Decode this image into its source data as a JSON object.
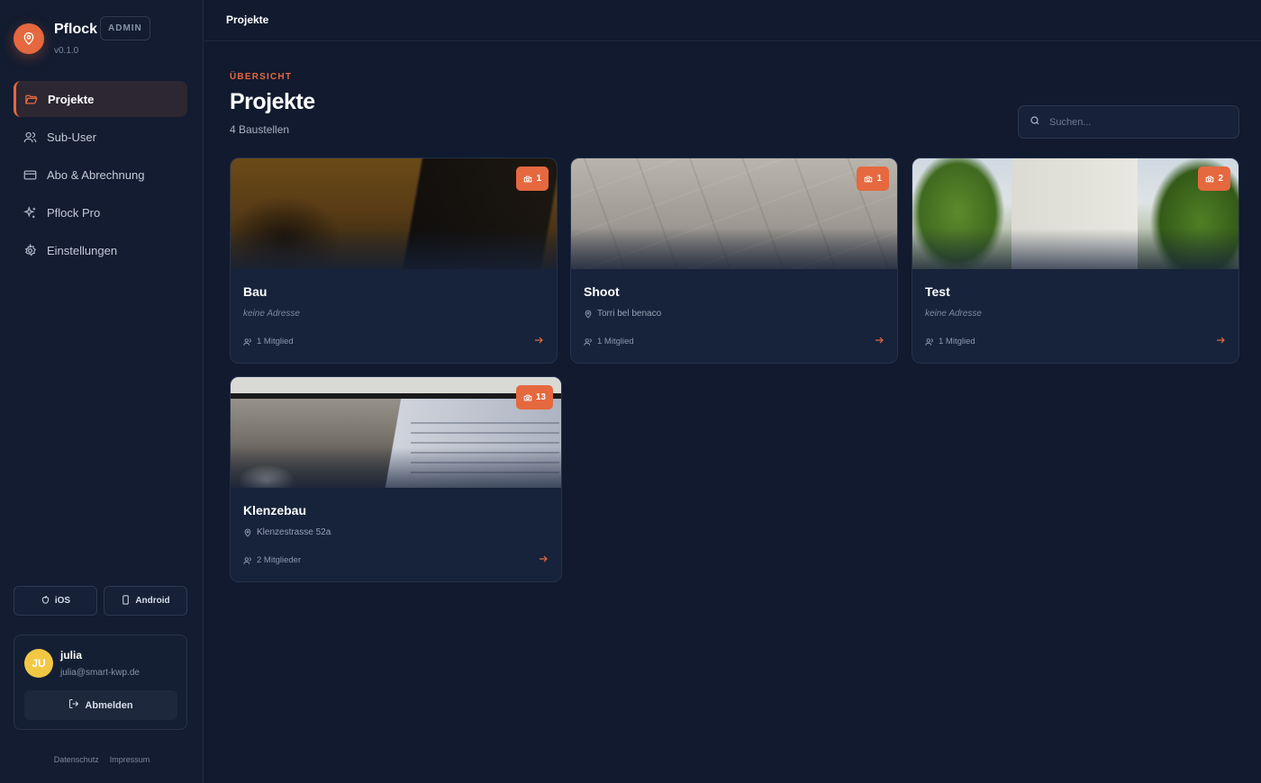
{
  "brand": {
    "name": "Pflock",
    "badge": "ADMIN",
    "version": "v0.1.0"
  },
  "nav": [
    {
      "label": "Projekte",
      "icon": "folder-icon",
      "active": true
    },
    {
      "label": "Sub-User",
      "icon": "users-icon"
    },
    {
      "label": "Abo & Abrechnung",
      "icon": "credit-card-icon"
    },
    {
      "label": "Pflock Pro",
      "icon": "sparkles-icon"
    },
    {
      "label": "Einstellungen",
      "icon": "gear-icon"
    }
  ],
  "apps": {
    "ios": "iOS",
    "android": "Android"
  },
  "user": {
    "initials": "JU",
    "name": "julia",
    "email": "julia@smart-kwp.de",
    "logout": "Abmelden"
  },
  "footer": {
    "privacy": "Datenschutz",
    "imprint": "Impressum"
  },
  "topbar": {
    "title": "Projekte"
  },
  "header": {
    "eyebrow": "ÜBERSICHT",
    "title": "Projekte",
    "subtitle": "4 Baustellen"
  },
  "search": {
    "placeholder": "Suchen..."
  },
  "projects": [
    {
      "title": "Bau",
      "address": "keine Adresse",
      "members": "1 Mitglied",
      "photos": "1"
    },
    {
      "title": "Shoot",
      "address": "Torri bel benaco",
      "members": "1 Mitglied",
      "photos": "1"
    },
    {
      "title": "Test",
      "address": "keine Adresse",
      "members": "1 Mitglied",
      "photos": "2"
    },
    {
      "title": "Klenzebau",
      "address": "Klenzestrasse 52a",
      "members": "2 Mitglieder",
      "photos": "13"
    }
  ],
  "colors": {
    "accent": "#e5683f",
    "background": "#111a2e",
    "card": "#17233b",
    "avatar": "#f2c744"
  }
}
